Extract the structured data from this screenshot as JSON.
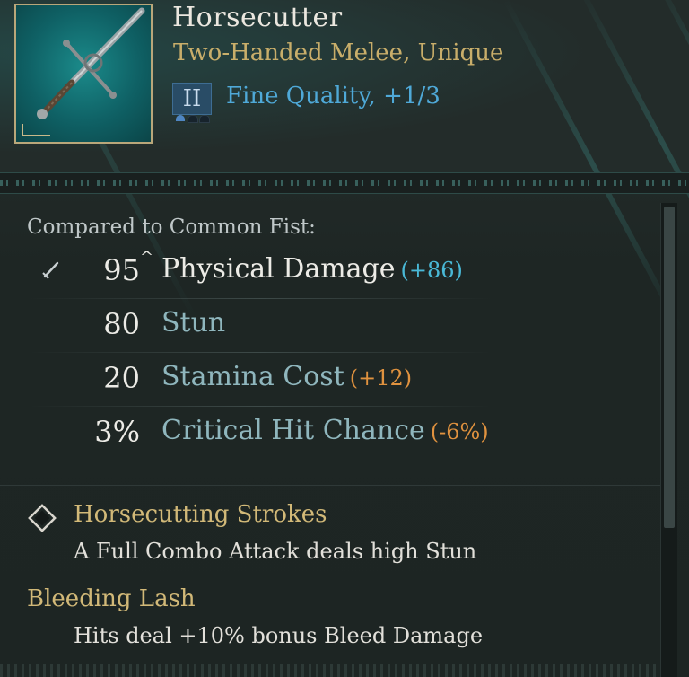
{
  "item": {
    "name": "Horsecutter",
    "type_line": "Two-Handed Melee, Unique",
    "quality_tier": "II",
    "quality_text": "Fine Quality, +1/3",
    "quality_pips": [
      "filled",
      "empty",
      "empty"
    ]
  },
  "comparison": {
    "label": "Compared to Common Fist:",
    "stats": [
      {
        "value": "95",
        "caret": "^",
        "name": "Physical Damage",
        "delta": "(+86)",
        "delta_color": "#49b8d6",
        "name_color": "#ecebe6",
        "icon": "sword-icon"
      },
      {
        "value": "80",
        "caret": "",
        "name": "Stun",
        "delta": "",
        "delta_color": "",
        "name_color": "#8fb6bd",
        "icon": ""
      },
      {
        "value": "20",
        "caret": "",
        "name": "Stamina Cost",
        "delta": "(+12)",
        "delta_color": "#e0923f",
        "name_color": "#8fb6bd",
        "icon": ""
      },
      {
        "value": "3%",
        "caret": "",
        "name": "Critical Hit Chance",
        "delta": "(-6%)",
        "delta_color": "#e0923f",
        "name_color": "#8fb6bd",
        "icon": ""
      }
    ]
  },
  "perks": [
    {
      "title": "Horsecutting Strokes",
      "description": "A Full Combo Attack deals high Stun",
      "icon": "diamond-icon"
    },
    {
      "title": "Bleeding Lash",
      "description": "Hits deal +10% bonus Bleed Damage",
      "icon": ""
    }
  ],
  "colors": {
    "title": "#ebe7df",
    "subtitle_gold": "#c9ae6a",
    "quality_blue": "#4fa9d8",
    "stat_label_teal": "#8fb6bd",
    "positive_delta": "#49b8d6",
    "negative_delta": "#e0923f",
    "perk_gold": "#d2b978"
  }
}
